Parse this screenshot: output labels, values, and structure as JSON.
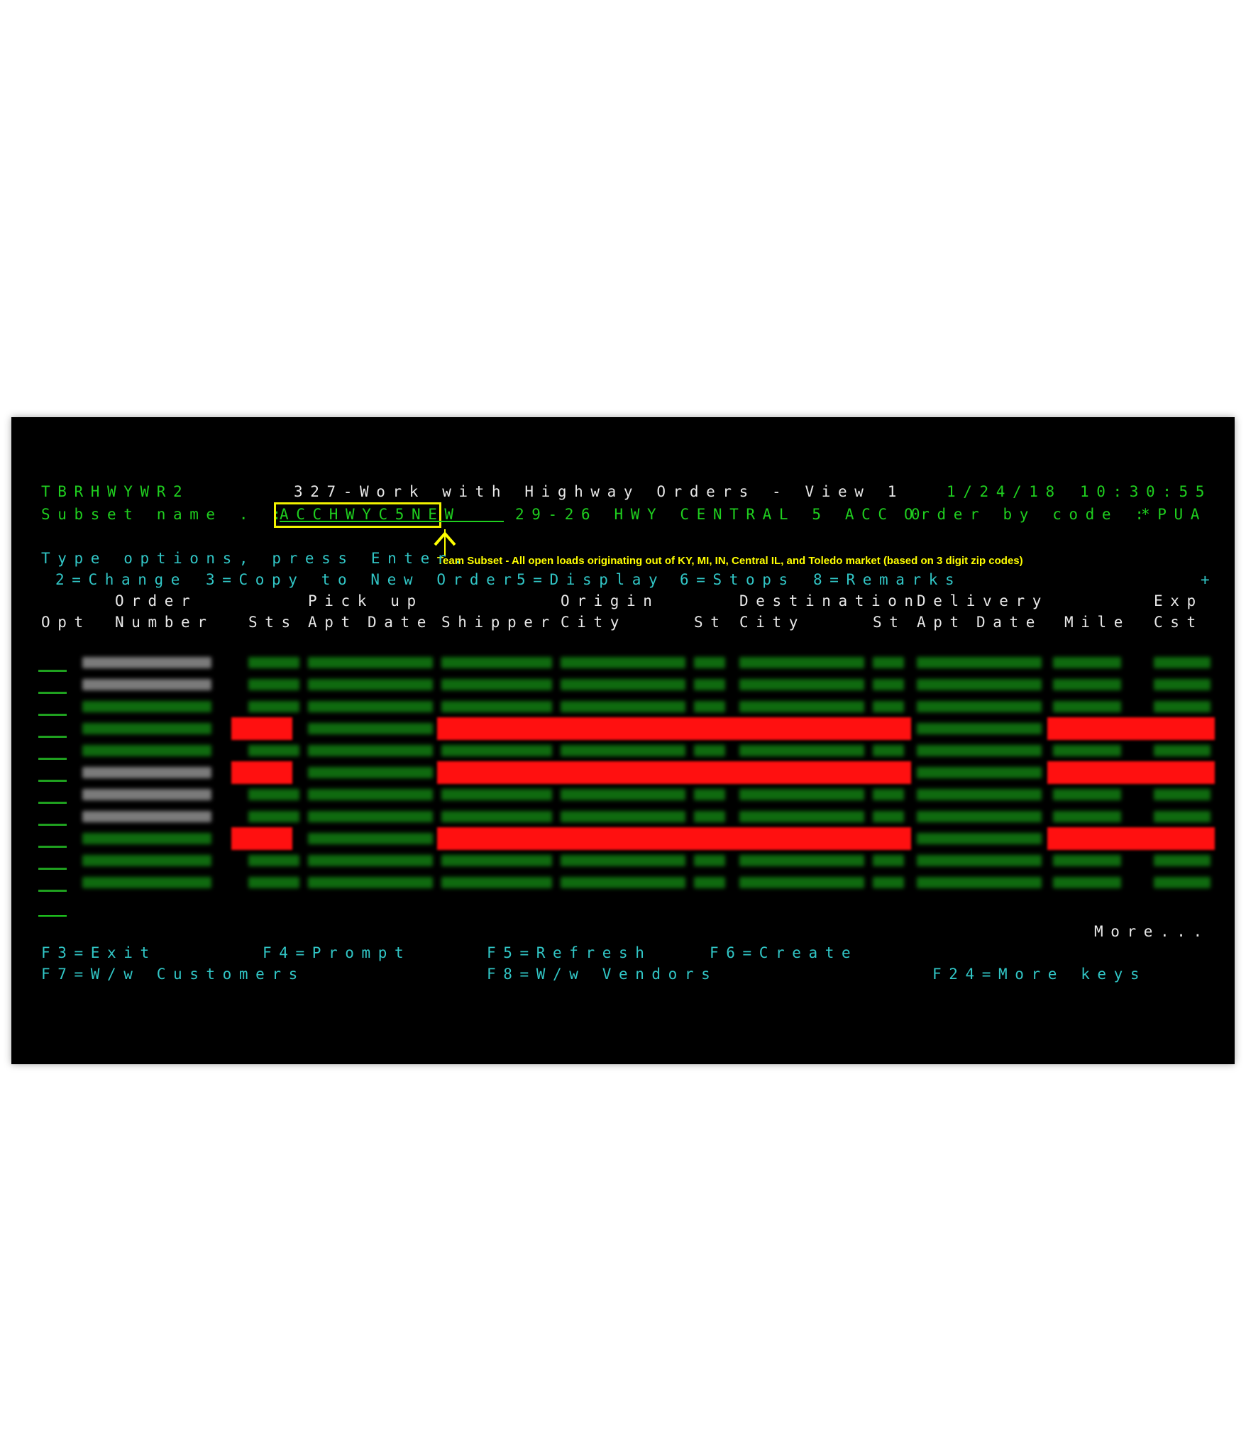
{
  "program": "TBRHWYWR2",
  "title": "327-Work with Highway Orders - View 1",
  "date": "1/24/18",
  "time": "10:30:55",
  "subset": {
    "label": "Subset name . :",
    "value": "ACCHWYC5NEW",
    "description": "29-26 HWY CENTRAL 5 ACC 0",
    "order_label": "Order by code :",
    "order_value": "*PUA"
  },
  "annotation": "Team Subset - All open loads originating out of KY, MI, IN, Central IL, and Toledo market (based on 3 digit zip codes)",
  "instructions": "Type options, press Enter.",
  "options": [
    "2=Change",
    "3=Copy to New Order",
    "5=Display",
    "6=Stops",
    "8=Remarks"
  ],
  "plus": "+",
  "header1": {
    "order": "Order",
    "pickup": "Pick up",
    "origin": "Origin",
    "destination": "Destination",
    "delivery": "Delivery",
    "exp": "Exp"
  },
  "header2": {
    "opt": "Opt",
    "number": "Number",
    "sts": "Sts",
    "apt": "Apt",
    "date": "Date",
    "shipper": "Shipper",
    "city": "City",
    "st": "St",
    "dcity": "City",
    "dst": "St",
    "dapt": "Apt",
    "ddate": "Date",
    "mile": "Mile",
    "cst": "Cst"
  },
  "more": "More...",
  "fkeys_row1": [
    "F3=Exit",
    "F4=Prompt",
    "F5=Refresh",
    "F6=Create"
  ],
  "fkeys_row2": [
    "F7=W/w Customers",
    "F8=W/w Vendors",
    "F24=More keys"
  ],
  "colors": {
    "green": "#1fcf1f",
    "cyan": "#31c6c6",
    "white": "#e8e8e8",
    "highlight": "#ff1010",
    "callout": "#ffff00"
  },
  "rows": [
    {
      "highlight": false
    },
    {
      "highlight": false
    },
    {
      "highlight": false
    },
    {
      "highlight": true
    },
    {
      "highlight": false
    },
    {
      "highlight": true
    },
    {
      "highlight": false
    },
    {
      "highlight": false
    },
    {
      "highlight": true
    },
    {
      "highlight": false
    },
    {
      "highlight": false
    }
  ]
}
